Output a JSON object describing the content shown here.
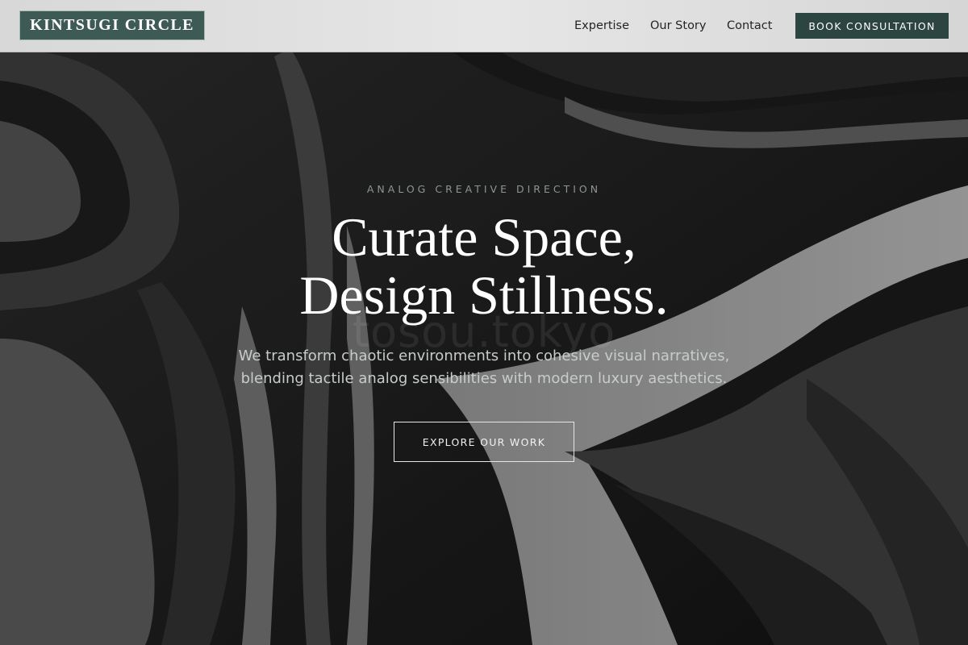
{
  "header": {
    "logo_text": "KINTSUGI CIRCLE",
    "nav": [
      "Expertise",
      "Our Story",
      "Contact"
    ],
    "cta_label": "BOOK CONSULTATION"
  },
  "hero": {
    "eyebrow": "ANALOG CREATIVE DIRECTION",
    "headline_line1": "Curate Space,",
    "headline_line2": "Design Stillness.",
    "watermark": "tosou.tokyo",
    "subtext_line1": "We transform chaotic environments into cohesive visual narratives,",
    "subtext_line2": "blending tactile analog sensibilities with modern luxury aesthetics.",
    "button_label": "EXPLORE OUR WORK"
  },
  "colors": {
    "brand": "#3e5a55",
    "cta": "#2c4541",
    "header_bg": "#dedede",
    "hero_bg": "#161616"
  }
}
